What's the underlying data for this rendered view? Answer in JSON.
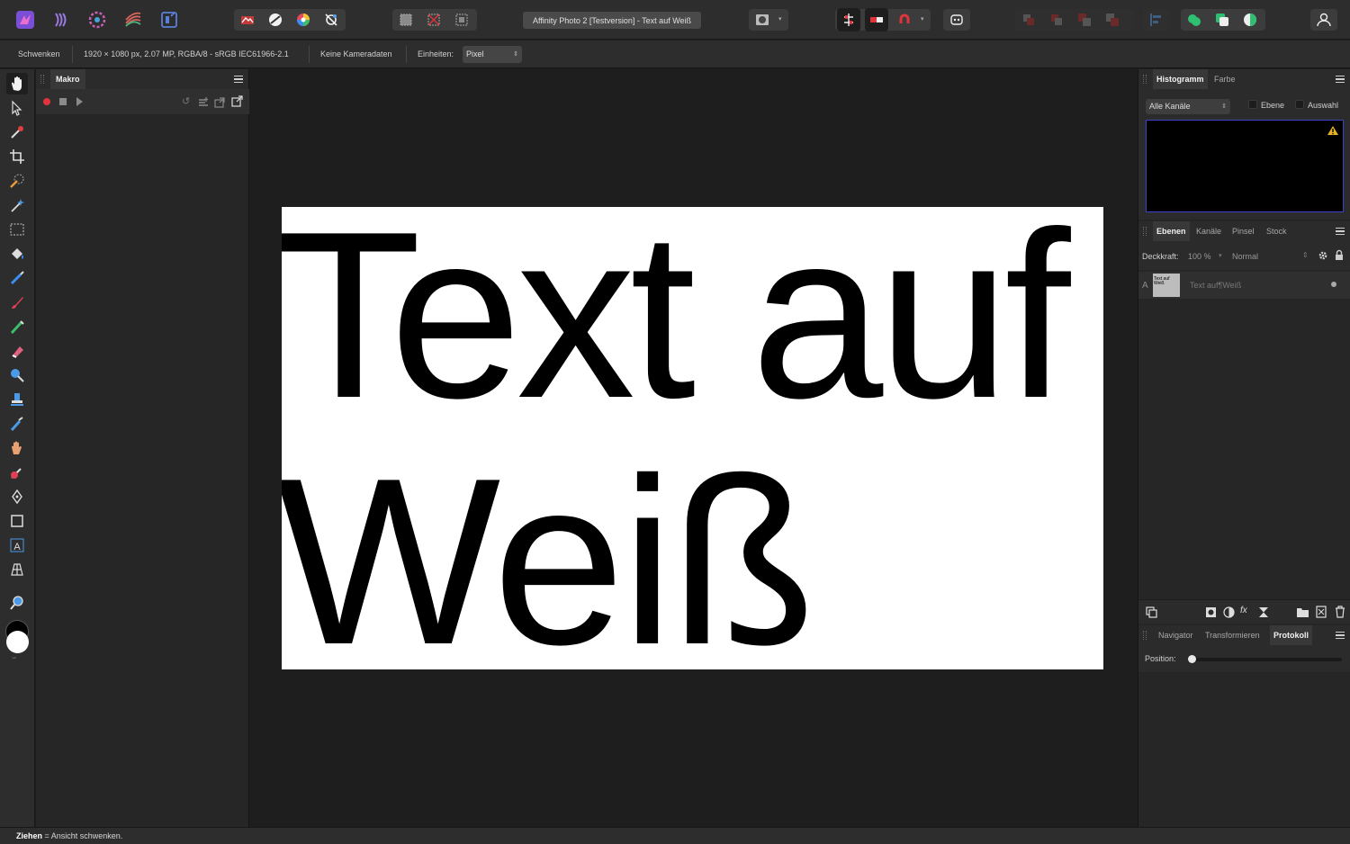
{
  "window": {
    "title": "Affinity Photo 2 [Testversion] - Text auf Weiß"
  },
  "context_bar": {
    "tool_name": "Schwenken",
    "doc_info": "1920 × 1080 px, 2.07 MP, RGBA/8 - sRGB IEC61966-2.1",
    "camera": "Keine Kameradaten",
    "units_label": "Einheiten:",
    "units_value": "Pixel"
  },
  "macro_panel": {
    "tab": "Makro"
  },
  "document": {
    "line1": "Text auf",
    "line2": "Weiß",
    "background": "#ffffff",
    "text_color": "#000000"
  },
  "histogram_panel": {
    "tabs": [
      "Histogramm",
      "Farbe"
    ],
    "channel_select": "Alle Kanäle",
    "check_layer": "Ebene",
    "check_selection": "Auswahl"
  },
  "layers_panel": {
    "tabs": [
      "Ebenen",
      "Kanäle",
      "Pinsel",
      "Stock"
    ],
    "opacity_label": "Deckkraft:",
    "opacity_value": "100 %",
    "blend_mode": "Normal",
    "layer": {
      "type_glyph": "A",
      "thumb_text": "Text auf Weiß",
      "name": "Text auf¶Weiß"
    }
  },
  "history_panel": {
    "tabs": [
      "Navigator",
      "Transformieren",
      "Protokoll"
    ],
    "position_label": "Position:",
    "position_value": 0
  },
  "status": {
    "key": "Ziehen",
    "text": " = Ansicht schwenken."
  },
  "colors": {
    "accent_red": "#e0343c",
    "histogram_border": "#3b44c8",
    "warning": "#e5b324"
  }
}
